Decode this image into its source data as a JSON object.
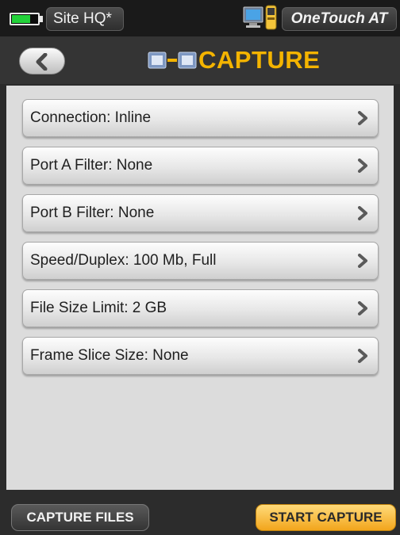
{
  "status_bar": {
    "battery_icon": "battery-icon",
    "battery_level": 0.68,
    "site_name": "Site HQ*",
    "network_status_icon": "network-computer-icon",
    "brand": "OneTouch AT"
  },
  "header": {
    "back_icon": "chevron-left-icon",
    "title_icon": "capture-icon",
    "title": "CAPTURE"
  },
  "settings": {
    "items": [
      {
        "label": "Connection: Inline"
      },
      {
        "label": "Port A Filter: None"
      },
      {
        "label": "Port B Filter: None"
      },
      {
        "label": "Speed/Duplex: 100 Mb, Full"
      },
      {
        "label": "File Size Limit: 2 GB"
      },
      {
        "label": "Frame Slice Size: None"
      }
    ],
    "item_icon": "chevron-right-icon"
  },
  "footer": {
    "capture_files_label": "CAPTURE FILES",
    "start_capture_label": "START CAPTURE"
  },
  "colors": {
    "accent": "#f4b400",
    "battery": "#23d23a",
    "start_button": "#f2a51c"
  }
}
